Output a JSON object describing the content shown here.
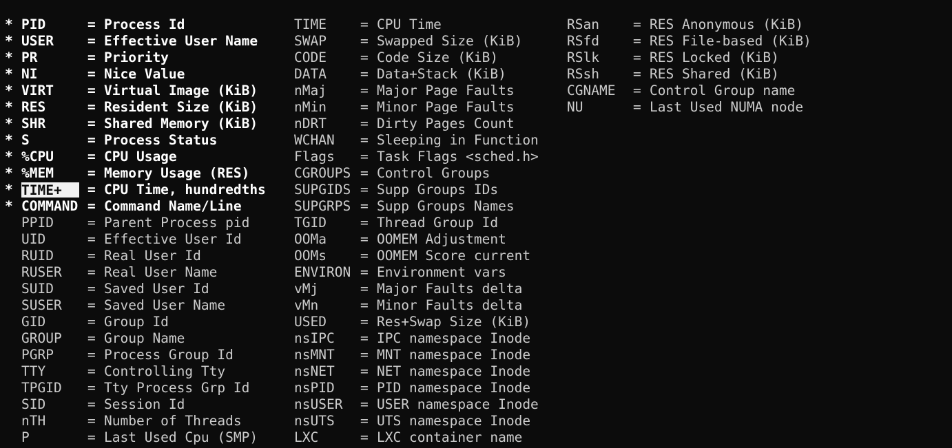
{
  "terminal": {
    "fields": {
      "col1": [
        {
          "mark": "*",
          "code": "PID",
          "eq": "=",
          "desc": "Process Id"
        },
        {
          "mark": "*",
          "code": "USER",
          "eq": "=",
          "desc": "Effective User Name"
        },
        {
          "mark": "*",
          "code": "PR",
          "eq": "=",
          "desc": "Priority"
        },
        {
          "mark": "*",
          "code": "NI",
          "eq": "=",
          "desc": "Nice Value"
        },
        {
          "mark": "*",
          "code": "VIRT",
          "eq": "=",
          "desc": "Virtual Image (KiB)"
        },
        {
          "mark": "*",
          "code": "RES",
          "eq": "=",
          "desc": "Resident Size (KiB)"
        },
        {
          "mark": "*",
          "code": "SHR",
          "eq": "=",
          "desc": "Shared Memory (KiB)"
        },
        {
          "mark": "*",
          "code": "S",
          "eq": "=",
          "desc": "Process Status"
        },
        {
          "mark": "*",
          "code": "%CPU",
          "eq": "=",
          "desc": "CPU Usage"
        },
        {
          "mark": "*",
          "code": "%MEM",
          "eq": "=",
          "desc": "Memory Usage (RES)"
        },
        {
          "mark": "*",
          "code": "TIME+",
          "eq": "=",
          "desc": "CPU Time, hundredths"
        },
        {
          "mark": "*",
          "code": "COMMAND",
          "eq": "=",
          "desc": "Command Name/Line"
        },
        {
          "mark": "",
          "code": "PPID",
          "eq": "=",
          "desc": "Parent Process pid"
        },
        {
          "mark": "",
          "code": "UID",
          "eq": "=",
          "desc": "Effective User Id"
        },
        {
          "mark": "",
          "code": "RUID",
          "eq": "=",
          "desc": "Real User Id"
        },
        {
          "mark": "",
          "code": "RUSER",
          "eq": "=",
          "desc": "Real User Name"
        },
        {
          "mark": "",
          "code": "SUID",
          "eq": "=",
          "desc": "Saved User Id"
        },
        {
          "mark": "",
          "code": "SUSER",
          "eq": "=",
          "desc": "Saved User Name"
        },
        {
          "mark": "",
          "code": "GID",
          "eq": "=",
          "desc": "Group Id"
        },
        {
          "mark": "",
          "code": "GROUP",
          "eq": "=",
          "desc": "Group Name"
        },
        {
          "mark": "",
          "code": "PGRP",
          "eq": "=",
          "desc": "Process Group Id"
        },
        {
          "mark": "",
          "code": "TTY",
          "eq": "=",
          "desc": "Controlling Tty"
        },
        {
          "mark": "",
          "code": "TPGID",
          "eq": "=",
          "desc": "Tty Process Grp Id"
        },
        {
          "mark": "",
          "code": "SID",
          "eq": "=",
          "desc": "Session Id"
        },
        {
          "mark": "",
          "code": "nTH",
          "eq": "=",
          "desc": "Number of Threads"
        },
        {
          "mark": "",
          "code": "P",
          "eq": "=",
          "desc": "Last Used Cpu (SMP)"
        }
      ],
      "col2": [
        {
          "code": "TIME",
          "eq": "=",
          "desc": "CPU Time"
        },
        {
          "code": "SWAP",
          "eq": "=",
          "desc": "Swapped Size (KiB)"
        },
        {
          "code": "CODE",
          "eq": "=",
          "desc": "Code Size (KiB)"
        },
        {
          "code": "DATA",
          "eq": "=",
          "desc": "Data+Stack (KiB)"
        },
        {
          "code": "nMaj",
          "eq": "=",
          "desc": "Major Page Faults"
        },
        {
          "code": "nMin",
          "eq": "=",
          "desc": "Minor Page Faults"
        },
        {
          "code": "nDRT",
          "eq": "=",
          "desc": "Dirty Pages Count"
        },
        {
          "code": "WCHAN",
          "eq": "=",
          "desc": "Sleeping in Function"
        },
        {
          "code": "Flags",
          "eq": "=",
          "desc": "Task Flags <sched.h>"
        },
        {
          "code": "CGROUPS",
          "eq": "=",
          "desc": "Control Groups"
        },
        {
          "code": "SUPGIDS",
          "eq": "=",
          "desc": "Supp Groups IDs"
        },
        {
          "code": "SUPGRPS",
          "eq": "=",
          "desc": "Supp Groups Names"
        },
        {
          "code": "TGID",
          "eq": "=",
          "desc": "Thread Group Id"
        },
        {
          "code": "OOMa",
          "eq": "=",
          "desc": "OOMEM Adjustment"
        },
        {
          "code": "OOMs",
          "eq": "=",
          "desc": "OOMEM Score current"
        },
        {
          "code": "ENVIRON",
          "eq": "=",
          "desc": "Environment vars"
        },
        {
          "code": "vMj",
          "eq": "=",
          "desc": "Major Faults delta"
        },
        {
          "code": "vMn",
          "eq": "=",
          "desc": "Minor Faults delta"
        },
        {
          "code": "USED",
          "eq": "=",
          "desc": "Res+Swap Size (KiB)"
        },
        {
          "code": "nsIPC",
          "eq": "=",
          "desc": "IPC namespace Inode"
        },
        {
          "code": "nsMNT",
          "eq": "=",
          "desc": "MNT namespace Inode"
        },
        {
          "code": "nsNET",
          "eq": "=",
          "desc": "NET namespace Inode"
        },
        {
          "code": "nsPID",
          "eq": "=",
          "desc": "PID namespace Inode"
        },
        {
          "code": "nsUSER",
          "eq": "=",
          "desc": "USER namespace Inode"
        },
        {
          "code": "nsUTS",
          "eq": "=",
          "desc": "UTS namespace Inode"
        },
        {
          "code": "LXC",
          "eq": "=",
          "desc": "LXC container name"
        }
      ],
      "col3": [
        {
          "code": "RSan",
          "eq": "=",
          "desc": "RES Anonymous (KiB)"
        },
        {
          "code": "RSfd",
          "eq": "=",
          "desc": "RES File-based (KiB)"
        },
        {
          "code": "RSlk",
          "eq": "=",
          "desc": "RES Locked (KiB)"
        },
        {
          "code": "RSsh",
          "eq": "=",
          "desc": "RES Shared (KiB)"
        },
        {
          "code": "CGNAME",
          "eq": "=",
          "desc": "Control Group name"
        },
        {
          "code": "NU",
          "eq": "=",
          "desc": "Last Used NUMA node"
        }
      ]
    },
    "colors": {
      "background": "#0c0c0c",
      "text": "#cccccc",
      "active_text": "#ffffff",
      "cursor_background": "#f2f2f2"
    }
  }
}
